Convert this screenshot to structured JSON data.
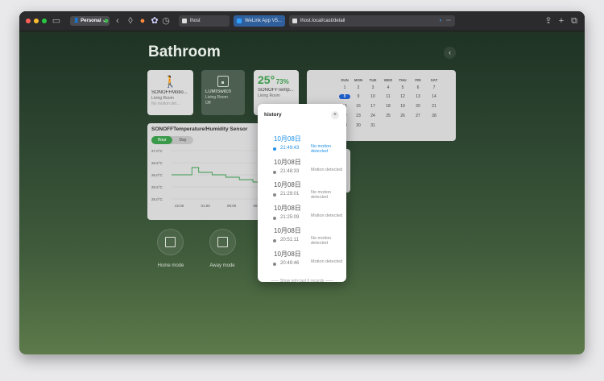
{
  "browser": {
    "profile_label": "Personal",
    "tabs": [
      {
        "label": "lhost"
      },
      {
        "label": "WeLink App V5..."
      },
      {
        "label": "lhost.local/cast/detail"
      }
    ],
    "icons": [
      "sidebar-icon",
      "profile-icon",
      "back-icon",
      "shield-icon",
      "fox-icon",
      "palette-icon",
      "history-icon",
      "share-icon",
      "plus-icon",
      "tabs-icon"
    ]
  },
  "page": {
    "title": "Bathroom",
    "back_icon": "chevron-left-icon"
  },
  "devices": [
    {
      "name": "SONOFFMotio...",
      "room": "Living Room",
      "status": "No motion det..."
    },
    {
      "name": "LUMISwitch",
      "room": "Living Room",
      "status": "Off"
    },
    {
      "name": "SONOFFTemp...",
      "room": "Living Room",
      "temperature": "25°",
      "humidity": "73%"
    }
  ],
  "chart": {
    "title": "SONOFFTemperature/Humidity Sensor",
    "toggle": {
      "hour": "Hour",
      "day": "Day"
    }
  },
  "chart_data": {
    "type": "line",
    "title": "SONOFFTemperature/Humidity Sensor",
    "y_ticks": [
      "27.0°C",
      "26.5°C",
      "26.0°C",
      "25.5°C",
      "25.0°C"
    ],
    "x_ticks": [
      "22:00",
      "01:00",
      "05:00",
      "09:00",
      "13:00"
    ],
    "ylim": [
      25.0,
      27.0
    ],
    "series": [
      {
        "values": [
          26.0,
          26.0,
          26.0,
          26.3,
          26.1,
          26.1,
          26.0,
          26.0,
          25.9,
          25.9,
          25.8,
          25.8,
          25.7,
          25.7,
          25.6,
          25.5,
          25.5,
          25.4,
          25.4,
          25.3
        ]
      }
    ],
    "grid": true,
    "line_color": "#3a9a4a"
  },
  "calendar": {
    "big_day": "8",
    "headers": [
      "SUN",
      "MON",
      "TUE",
      "WED",
      "THU",
      "FRI",
      "SAT"
    ],
    "rows": [
      [
        "",
        "1",
        "2",
        "3",
        "4",
        "5",
        "6",
        "7"
      ],
      [
        "",
        "8",
        "9",
        "10",
        "11",
        "12",
        "13",
        "14"
      ],
      [
        "15",
        "16",
        "17",
        "18",
        "19",
        "20",
        "21"
      ],
      [
        "22",
        "23",
        "24",
        "25",
        "26",
        "27",
        "28"
      ],
      [
        "29",
        "30",
        "31",
        "",
        "",
        "",
        ""
      ]
    ],
    "selected": "8"
  },
  "modes": [
    {
      "label": "Home mode"
    },
    {
      "label": "Away mode"
    }
  ],
  "history": {
    "title": "history",
    "records": [
      {
        "date": "10月08日",
        "time": "21:49:43",
        "status": "No motion detected",
        "highlight": true
      },
      {
        "date": "10月08日",
        "time": "21:48:33",
        "status": "Motion detected",
        "highlight": false
      },
      {
        "date": "10月08日",
        "time": "21:29:01",
        "status": "No motion detected",
        "highlight": false
      },
      {
        "date": "10月08日",
        "time": "21:25:09",
        "status": "Motion detected",
        "highlight": false
      },
      {
        "date": "10月08日",
        "time": "20:51:11",
        "status": "No motion detected",
        "highlight": false
      },
      {
        "date": "10月08日",
        "time": "20:49:46",
        "status": "Motion detected",
        "highlight": false
      }
    ],
    "footer": "Show only last 6 records"
  }
}
